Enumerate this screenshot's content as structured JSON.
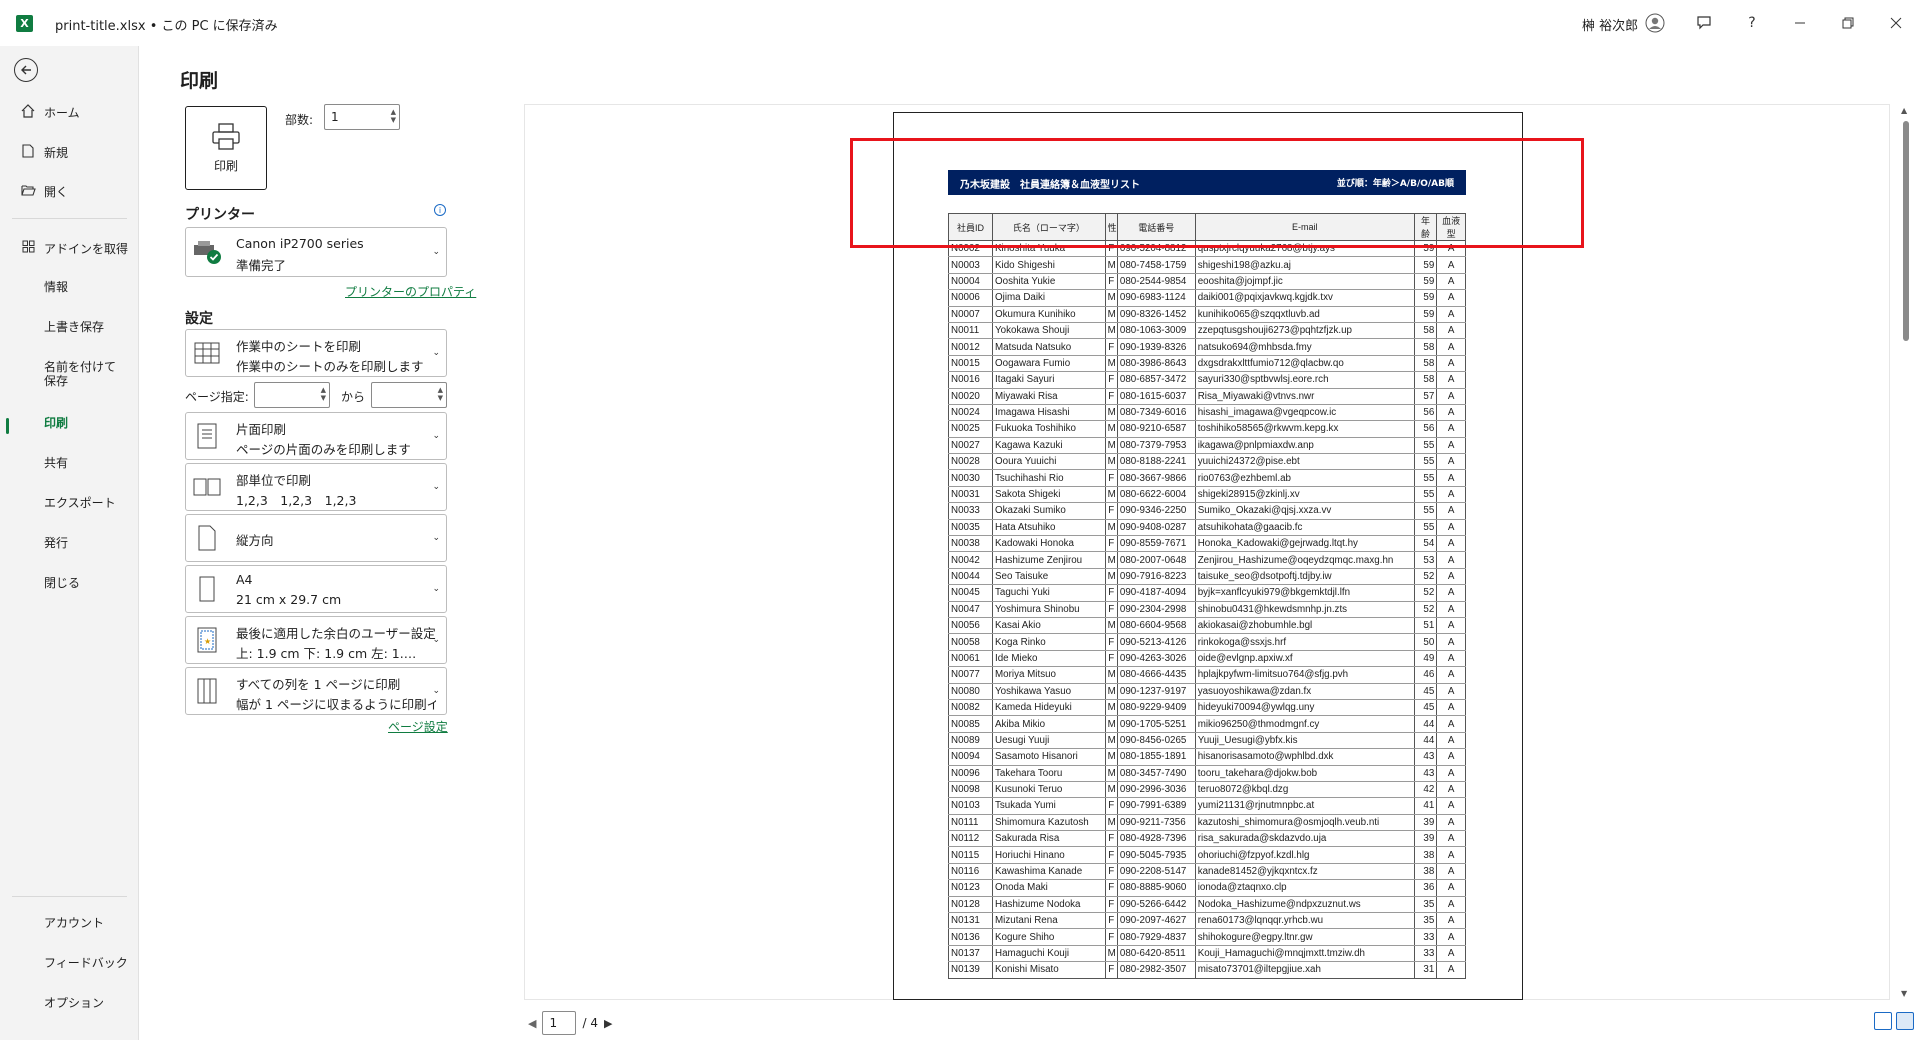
{
  "titlebar": {
    "app_logo": "X",
    "title": "print-title.xlsx • この PC に保存済み",
    "user": "榊 裕次郎",
    "icons": [
      "user-avatar-icon",
      "feedback-icon",
      "help-icon",
      "minimize-icon",
      "restore-icon",
      "close-icon"
    ],
    "help_glyph": "?"
  },
  "nav": {
    "items": [
      {
        "key": "home",
        "label": "ホーム",
        "icon": "home-icon"
      },
      {
        "key": "new",
        "label": "新規",
        "icon": "new-document-icon"
      },
      {
        "key": "open",
        "label": "開く",
        "icon": "folder-open-icon"
      },
      {
        "key": "addins",
        "label": "アドインを取得",
        "icon": "addins-grid-icon"
      },
      {
        "key": "info",
        "label": "情報"
      },
      {
        "key": "save",
        "label": "上書き保存"
      },
      {
        "key": "saveas",
        "label": "名前を付けて保存"
      },
      {
        "key": "print",
        "label": "印刷",
        "selected": true
      },
      {
        "key": "share",
        "label": "共有"
      },
      {
        "key": "export",
        "label": "エクスポート"
      },
      {
        "key": "publish",
        "label": "発行"
      },
      {
        "key": "close",
        "label": "閉じる"
      },
      {
        "key": "account",
        "label": "アカウント"
      },
      {
        "key": "feedback",
        "label": "フィードバック"
      },
      {
        "key": "options",
        "label": "オプション"
      }
    ]
  },
  "print": {
    "heading": "印刷",
    "button_label": "印刷",
    "copies_label": "部数:",
    "copies_value": "1",
    "printer_heading": "プリンター",
    "printer_name": "Canon iP2700 series",
    "printer_status": "準備完了",
    "printer_props_link": "プリンターのプロパティ",
    "settings_heading": "設定",
    "what_l1": "作業中のシートを印刷",
    "what_l2": "作業中のシートのみを印刷します",
    "pages_label": "ページ指定:",
    "to_label": "から",
    "sided_l1": "片面印刷",
    "sided_l2": "ページの片面のみを印刷します",
    "collate_l1": "部単位で印刷",
    "collate_l2": "1,2,3　1,2,3　1,2,3",
    "orientation": "縦方向",
    "paper_l1": "A4",
    "paper_l2": "21 cm x 29.7 cm",
    "margin_l1": "最後に適用した余白のユーザー設定",
    "margin_l2": "上: 1.9 cm 下: 1.9 cm 左: 1.…",
    "scale_l1": "すべての列を 1 ページに印刷",
    "scale_l2": "幅が 1 ページに収まるように印刷イ…",
    "page_setup_link": "ページ設定"
  },
  "preview": {
    "doc_title": "乃木坂建設　社員連絡簿＆血液型リスト",
    "doc_sort": "並び順：年齢＞A/B/O/AB順",
    "columns": [
      "社員ID",
      "氏名（ローマ字）",
      "性",
      "電話番号",
      "E-mail",
      "年齢",
      "血液型"
    ],
    "rows": [
      [
        "N0002",
        "Kinoshita Yuuka",
        "F",
        "090-5204-8812",
        "qusptxjrclqyuuka2768@btjy.ays",
        "59",
        "A"
      ],
      [
        "N0003",
        "Kido Shigeshi",
        "M",
        "080-7458-1759",
        "shigeshi198@azku.aj",
        "59",
        "A"
      ],
      [
        "N0004",
        "Ooshita Yukie",
        "F",
        "080-2544-9854",
        "eooshita@jojmpf.jic",
        "59",
        "A"
      ],
      [
        "N0006",
        "Ojima Daiki",
        "M",
        "090-6983-1124",
        "daiki001@pqixjavkwq.kgjdk.txv",
        "59",
        "A"
      ],
      [
        "N0007",
        "Okumura Kunihiko",
        "M",
        "090-8326-1452",
        "kunihiko065@szqqxtluvb.ad",
        "59",
        "A"
      ],
      [
        "N0011",
        "Yokokawa Shouji",
        "M",
        "080-1063-3009",
        "zzepqtusgshouji6273@pqhtzfjzk.up",
        "58",
        "A"
      ],
      [
        "N0012",
        "Matsuda Natsuko",
        "F",
        "090-1939-8326",
        "natsuko694@mhbsda.fmy",
        "58",
        "A"
      ],
      [
        "N0015",
        "Oogawara Fumio",
        "M",
        "080-3986-8643",
        "dxgsdrakxlttfumio712@qlacbw.qo",
        "58",
        "A"
      ],
      [
        "N0016",
        "Itagaki Sayuri",
        "F",
        "080-6857-3472",
        "sayuri330@sptbvwlsj.eore.rch",
        "58",
        "A"
      ],
      [
        "N0020",
        "Miyawaki Risa",
        "F",
        "080-1615-6037",
        "Risa_Miyawaki@vtnvs.nwr",
        "57",
        "A"
      ],
      [
        "N0024",
        "Imagawa Hisashi",
        "M",
        "080-7349-6016",
        "hisashi_imagawa@vgeqpcow.ic",
        "56",
        "A"
      ],
      [
        "N0025",
        "Fukuoka Toshihiko",
        "M",
        "080-9210-6587",
        "toshihiko58565@rkwvm.kepg.kx",
        "56",
        "A"
      ],
      [
        "N0027",
        "Kagawa Kazuki",
        "M",
        "080-7379-7953",
        "ikagawa@pnlpmiaxdw.anp",
        "55",
        "A"
      ],
      [
        "N0028",
        "Ooura Yuuichi",
        "M",
        "080-8188-2241",
        "yuuichi24372@pise.ebt",
        "55",
        "A"
      ],
      [
        "N0030",
        "Tsuchihashi Rio",
        "F",
        "080-3667-9866",
        "rio0763@ezhbeml.ab",
        "55",
        "A"
      ],
      [
        "N0031",
        "Sakota Shigeki",
        "M",
        "080-6622-6004",
        "shigeki28915@zkinlj.xv",
        "55",
        "A"
      ],
      [
        "N0033",
        "Okazaki Sumiko",
        "F",
        "090-9346-2250",
        "Sumiko_Okazaki@qjsj.xxza.vv",
        "55",
        "A"
      ],
      [
        "N0035",
        "Hata Atsuhiko",
        "M",
        "090-9408-0287",
        "atsuhikohata@gaacib.fc",
        "55",
        "A"
      ],
      [
        "N0038",
        "Kadowaki Honoka",
        "F",
        "090-8559-7671",
        "Honoka_Kadowaki@gejrwadg.ltqt.hy",
        "54",
        "A"
      ],
      [
        "N0042",
        "Hashizume Zenjirou",
        "M",
        "080-2007-0648",
        "Zenjirou_Hashizume@oqeydzqmqc.maxg.hn",
        "53",
        "A"
      ],
      [
        "N0044",
        "Seo Taisuke",
        "M",
        "090-7916-8223",
        "taisuke_seo@dsotpoftj.tdjby.iw",
        "52",
        "A"
      ],
      [
        "N0045",
        "Taguchi Yuki",
        "F",
        "090-4187-4094",
        "byjk=xanflcyuki979@bkgemktdjl.lfn",
        "52",
        "A"
      ],
      [
        "N0047",
        "Yoshimura Shinobu",
        "F",
        "090-2304-2998",
        "shinobu0431@hkewdsmnhp.jn.zts",
        "52",
        "A"
      ],
      [
        "N0056",
        "Kasai Akio",
        "M",
        "080-6604-9568",
        "akiokasai@zhobumhle.bgl",
        "51",
        "A"
      ],
      [
        "N0058",
        "Koga Rinko",
        "F",
        "090-5213-4126",
        "rinkokoga@ssxjs.hrf",
        "50",
        "A"
      ],
      [
        "N0061",
        "Ide Mieko",
        "F",
        "090-4263-3026",
        "oide@evlgnp.apxiw.xf",
        "49",
        "A"
      ],
      [
        "N0077",
        "Moriya Mitsuo",
        "M",
        "080-4666-4435",
        "hplajkpyfwm-limitsuo764@sfjg.pvh",
        "46",
        "A"
      ],
      [
        "N0080",
        "Yoshikawa Yasuo",
        "M",
        "090-1237-9197",
        "yasuoyoshikawa@zdan.fx",
        "45",
        "A"
      ],
      [
        "N0082",
        "Kameda Hideyuki",
        "M",
        "080-9229-9409",
        "hideyuki70094@ywlqg.uny",
        "45",
        "A"
      ],
      [
        "N0085",
        "Akiba Mikio",
        "M",
        "090-1705-5251",
        "mikio96250@thmodmgnf.cy",
        "44",
        "A"
      ],
      [
        "N0089",
        "Uesugi Yuuji",
        "M",
        "090-8456-0265",
        "Yuuji_Uesugi@ybfx.kis",
        "44",
        "A"
      ],
      [
        "N0094",
        "Sasamoto Hisanori",
        "M",
        "080-1855-1891",
        "hisanorisasamoto@wphlbd.dxk",
        "43",
        "A"
      ],
      [
        "N0096",
        "Takehara Tooru",
        "M",
        "080-3457-7490",
        "tooru_takehara@djokw.bob",
        "43",
        "A"
      ],
      [
        "N0098",
        "Kusunoki Teruo",
        "M",
        "090-2996-3036",
        "teruo8072@kbql.dzg",
        "42",
        "A"
      ],
      [
        "N0103",
        "Tsukada Yumi",
        "F",
        "090-7991-6389",
        "yumi21131@rjnutmnpbc.at",
        "41",
        "A"
      ],
      [
        "N0111",
        "Shimomura Kazutosh",
        "M",
        "090-9211-7356",
        "kazutoshi_shimomura@osmjoqlh.veub.nti",
        "39",
        "A"
      ],
      [
        "N0112",
        "Sakurada Risa",
        "F",
        "080-4928-7396",
        "risa_sakurada@skdazvdo.uja",
        "39",
        "A"
      ],
      [
        "N0115",
        "Horiuchi Hinano",
        "F",
        "090-5045-7935",
        "ohoriuchi@fzpyof.kzdl.hlg",
        "38",
        "A"
      ],
      [
        "N0116",
        "Kawashima Kanade",
        "F",
        "090-2208-5147",
        "kanade81452@yjkqxntcx.fz",
        "38",
        "A"
      ],
      [
        "N0123",
        "Onoda Maki",
        "F",
        "080-8885-9060",
        "ionoda@ztaqnxo.clp",
        "36",
        "A"
      ],
      [
        "N0128",
        "Hashizume Nodoka",
        "F",
        "090-5266-6442",
        "Nodoka_Hashizume@ndpxzuznut.ws",
        "35",
        "A"
      ],
      [
        "N0131",
        "Mizutani Rena",
        "F",
        "090-2097-4627",
        "rena60173@lqnqqr.yrhcb.wu",
        "35",
        "A"
      ],
      [
        "N0136",
        "Kogure Shiho",
        "F",
        "080-7929-4837",
        "shihokogure@egpy.ltnr.gw",
        "33",
        "A"
      ],
      [
        "N0137",
        "Hamaguchi Kouji",
        "M",
        "080-6420-8511",
        "Kouji_Hamaguchi@mnqjmxtt.tmziw.dh",
        "33",
        "A"
      ],
      [
        "N0139",
        "Konishi Misato",
        "F",
        "080-2982-3507",
        "misato73701@iltepgjiue.xah",
        "31",
        "A"
      ]
    ],
    "current_page": "1",
    "total_pages": "/ 4"
  }
}
